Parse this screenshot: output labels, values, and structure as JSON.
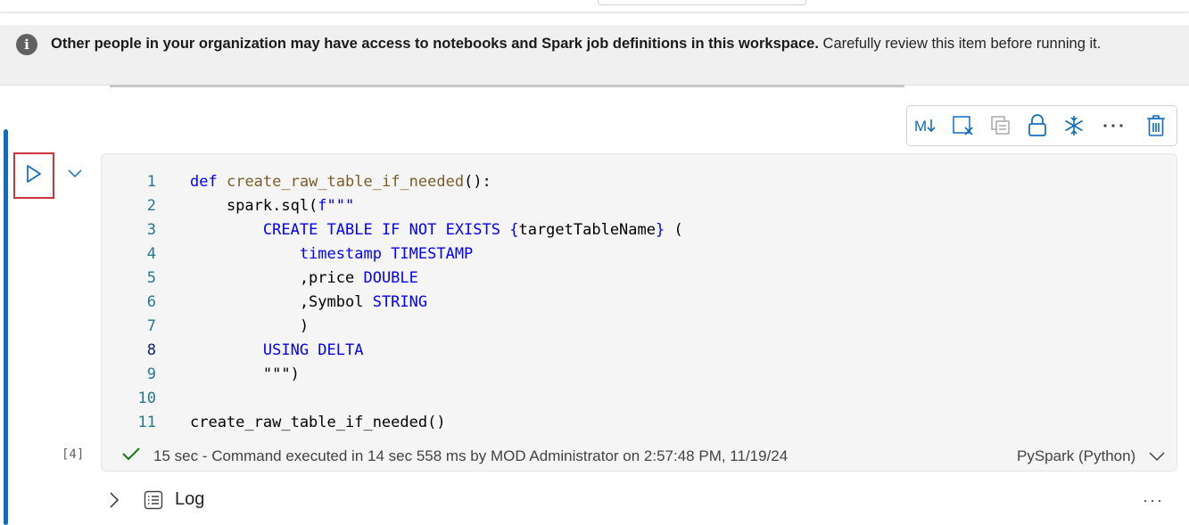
{
  "banner": {
    "icon": "info-icon",
    "bold_text": "Other people in your organization may have access to notebooks and Spark job definitions in this workspace.",
    "text": " Carefully review this item before running it."
  },
  "toolbar": {
    "items": [
      "markdown-toggle-icon",
      "clear-output-icon",
      "copy-cell-icon",
      "lock-icon",
      "freeze-icon",
      "more-icon",
      "delete-icon"
    ]
  },
  "cell": {
    "execution_count": "[4]",
    "code_lines": [
      {
        "n": "1",
        "parts": [
          [
            "kw",
            "def"
          ],
          [
            "",
            " "
          ],
          [
            "fn",
            "create_raw_table_if_needed"
          ],
          [
            "",
            "():"
          ]
        ]
      },
      {
        "n": "2",
        "parts": [
          [
            "",
            "    spark.sql("
          ],
          [
            "kw",
            "f\"\"\""
          ]
        ]
      },
      {
        "n": "3",
        "parts": [
          [
            "",
            "        "
          ],
          [
            "kw",
            "CREATE TABLE IF NOT EXISTS {"
          ],
          [
            "",
            "targetTableName"
          ],
          [
            "kw",
            "}"
          ],
          [
            "",
            " ("
          ]
        ]
      },
      {
        "n": "4",
        "parts": [
          [
            "",
            "            "
          ],
          [
            "kw",
            "timestamp TIMESTAMP"
          ]
        ]
      },
      {
        "n": "5",
        "parts": [
          [
            "",
            "            ,price "
          ],
          [
            "kw",
            "DOUBLE"
          ]
        ]
      },
      {
        "n": "6",
        "parts": [
          [
            "",
            "            ,Symbol "
          ],
          [
            "kw",
            "STRING"
          ]
        ]
      },
      {
        "n": "7",
        "parts": [
          [
            "",
            "            )"
          ]
        ]
      },
      {
        "n": "8",
        "parts": [
          [
            "",
            "        "
          ],
          [
            "kw",
            "USING DELTA"
          ]
        ]
      },
      {
        "n": "9",
        "parts": [
          [
            "",
            "        \"\"\")"
          ]
        ]
      },
      {
        "n": "10",
        "parts": [
          [
            "",
            ""
          ]
        ]
      },
      {
        "n": "11",
        "parts": [
          [
            "",
            "create_raw_table_if_needed()"
          ]
        ]
      }
    ],
    "current_line": "8",
    "status_text": "15 sec - Command executed in 14 sec 558 ms by MOD Administrator on 2:57:48 PM, 11/19/24",
    "language": "PySpark (Python)"
  },
  "log": {
    "label": "Log"
  },
  "colors": {
    "accent": "#0f6cbd",
    "highlight": "#d13438",
    "success": "#107c10"
  }
}
